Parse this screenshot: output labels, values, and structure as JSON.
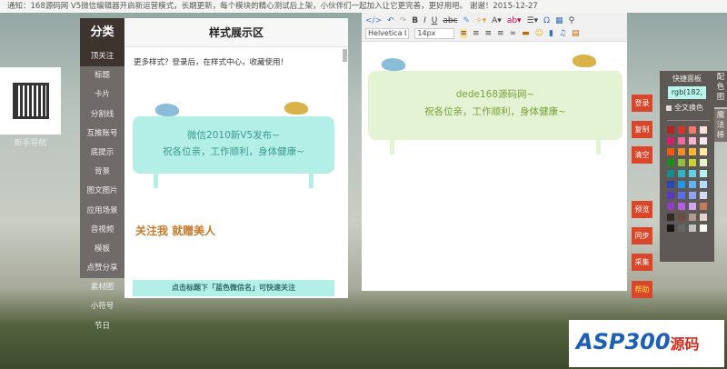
{
  "notice": "通知：168源码网 V5微信编辑器开启新运营模式，长期更新，每个模块的精心测试后上架，小伙伴们一起加入让它更完善，更好用吧。 谢谢！2015-12-27",
  "sidebar_guide": "新手导航",
  "category": {
    "title": "分类",
    "items": [
      "顶关注",
      "标题",
      "卡片",
      "分割线",
      "互推账号",
      "底提示",
      "背景",
      "图文图片",
      "应用场景",
      "音视频",
      "模板",
      "点赞分享"
    ],
    "plain_items": [
      "素材图",
      "小符号",
      "节日"
    ]
  },
  "showcase": {
    "title": "样式展示区",
    "tip": "更多样式？登录后，在样式中心，收藏使用！",
    "card_line1": "微信2010新V5发布~",
    "card_line2": "祝各位亲，工作顺利，身体健康~",
    "promo": "关注我 就赠美人",
    "footer": "点击标题下「蓝色微信名」可快速关注"
  },
  "editor": {
    "font": "Helvetica I",
    "size": "14px",
    "card_line1": "dede168源码网~",
    "card_line2": "祝各位亲，工作顺利，身体健康~"
  },
  "buttons": [
    "登录",
    "复制",
    "清空",
    "预览",
    "同步",
    "采集",
    "帮助"
  ],
  "palette": {
    "title": "快捷面板",
    "rgb": "rgb(182, 24",
    "checkbox": "全文换色",
    "colors": [
      "#b1231c",
      "#e0302a",
      "#f0786a",
      "#fbe3dc",
      "#d81d6a",
      "#ef6aa0",
      "#f6b4cf",
      "#fce6ef",
      "#ef5b12",
      "#f98c1c",
      "#fdb62d",
      "#fde9a9",
      "#14901e",
      "#8cbf3a",
      "#c9d22e",
      "#e7f3cc",
      "#178b85",
      "#2cb6c7",
      "#5fd2e9",
      "#b7f5ee",
      "#2a48b5",
      "#2196ef",
      "#5fb4f8",
      "#b9dcfd",
      "#5a39c2",
      "#5a6cf2",
      "#8fa3f9",
      "#d3dcfe",
      "#8d3cc4",
      "#b45ee7",
      "#d3a4f4",
      "#c4795b",
      "#3a2a25",
      "#6c4d41",
      "#b09a8f",
      "#e0d4d0",
      "#151515",
      "#666666",
      "#c2c2c2",
      "#fafafa"
    ]
  },
  "side_tabs": [
    "配色图",
    "魔法棒"
  ],
  "logo": {
    "text": "ASP300",
    "suffix": "源码"
  }
}
